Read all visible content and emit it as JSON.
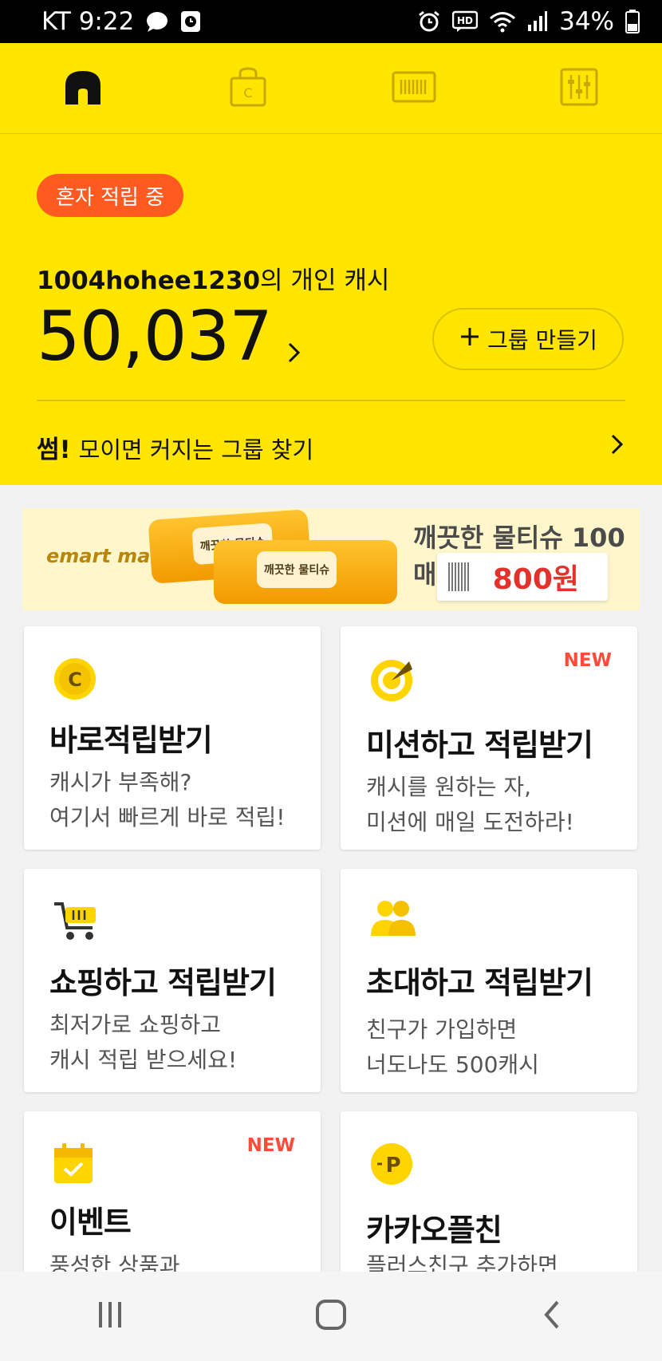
{
  "status_bar": {
    "carrier_time": "KT 9:22",
    "network": "HD",
    "battery": "34%"
  },
  "top_nav": {
    "tabs": [
      {
        "name": "home-icon",
        "active": true
      },
      {
        "name": "shopping-bag-icon",
        "active": false
      },
      {
        "name": "barcode-icon",
        "active": false
      },
      {
        "name": "settings-sliders-icon",
        "active": false
      }
    ]
  },
  "hero": {
    "status_pill": "혼자 적립 중",
    "owner_id": "1004hohee1230",
    "owner_suffix": "의 개인 캐시",
    "cash_amount": "50,037",
    "group_button": "그룹 만들기",
    "find_prefix": "썸!",
    "find_text": "모이면 커지는 그룹 찾기"
  },
  "banner": {
    "brand": "emart mall",
    "headline": "깨끗한 물티슈 100매",
    "price": "800원",
    "pack_label": "깨끗한 물티슈"
  },
  "cards": [
    {
      "title": "바로적립받기",
      "desc": [
        "캐시가 부족해?",
        "여기서 빠르게 바로 적립!"
      ],
      "icon": "coin-c-icon",
      "new": ""
    },
    {
      "title": "미션하고 적립받기",
      "desc": [
        "캐시를 원하는 자,",
        "미션에 매일 도전하라!"
      ],
      "icon": "target-icon",
      "new": "NEW"
    },
    {
      "title": "쇼핑하고 적립받기",
      "desc": [
        "최저가로 쇼핑하고",
        "캐시 적립 받으세요!"
      ],
      "icon": "cart-icon",
      "new": ""
    },
    {
      "title": "초대하고 적립받기",
      "desc": [
        "친구가 가입하면",
        "너도나도 500캐시"
      ],
      "icon": "people-icon",
      "new": ""
    },
    {
      "title": "이벤트",
      "desc": [
        "풍성한 상품과"
      ],
      "icon": "calendar-icon",
      "new": "NEW"
    },
    {
      "title": "카카오플친",
      "desc": [
        "플러스친구 추가하면"
      ],
      "icon": "plus-friend-p-icon",
      "new": ""
    }
  ],
  "colors": {
    "brand_yellow": "#ffe500",
    "pill_orange": "#ff5a1f",
    "new_red": "#ff4b3a",
    "price_red": "#e2322b"
  }
}
